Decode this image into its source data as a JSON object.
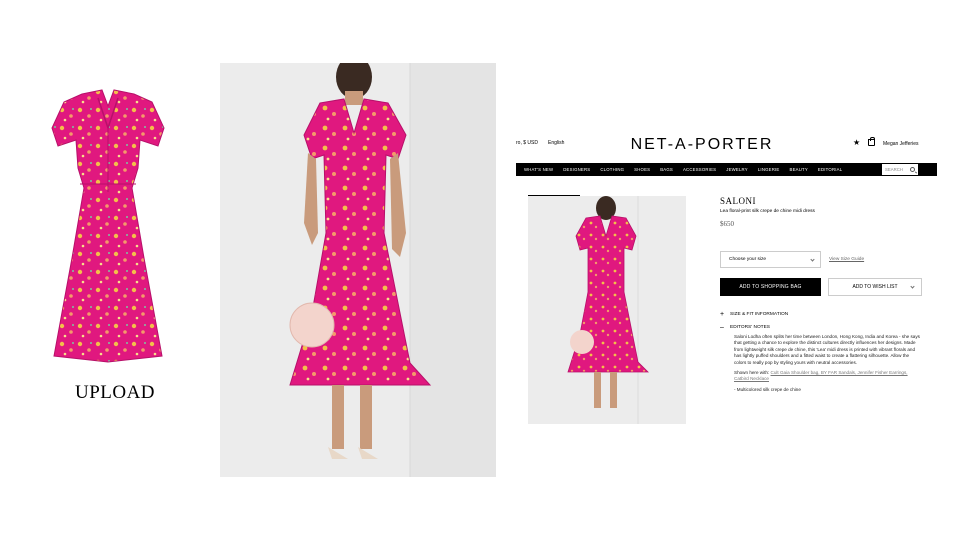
{
  "upload": {
    "label": "UPLOAD"
  },
  "store": {
    "logo": "NET-A-PORTER",
    "currency": "ro, $ USD",
    "language": "English",
    "account_name": "Megan Jefferies",
    "nav": [
      "WHAT'S NEW",
      "DESIGNERS",
      "CLOTHING",
      "SHOES",
      "BAGS",
      "ACCESSORIES",
      "JEWELRY",
      "LINGERIE",
      "BEAUTY",
      "EDITORIAL"
    ],
    "search_label": "SEARCH",
    "product": {
      "brand": "SALONI",
      "name": "Lea floral-print silk crepe de chine midi dress",
      "price": "$650",
      "size_placeholder": "Choose your size",
      "size_guide": "View Size Guide",
      "add_to_bag": "ADD TO SHOPPING BAG",
      "add_to_wishlist": "ADD TO WISH LIST",
      "section_size_fit": "SIZE & FIT INFORMATION",
      "section_editors_notes": "EDITORS' NOTES",
      "notes_body": "Saloni Lodha often splits her time between London, Hong Kong, India and Korea - she says that getting a chance to explore the distinct cultures directly influences her designs. Made from lightweight silk crepe de chine, this 'Lea' midi dress is printed with vibrant florals and has lightly puffed shoulders and a fitted waist to create a flattering silhouette. Allow the colors to really pop by styling yours with neutral accessories.",
      "shown_here_prefix": "Shown here with:",
      "shown_here_items": "Cult Gaia Shoulder bag, BY FAR Sandals, Jennifer Fisher Earrings, Catbird Necklace",
      "bullet_1": "- Multicolored silk crepe de chine"
    }
  },
  "colors": {
    "dress_pink": "#e0187f",
    "dress_dark": "#b8106a",
    "print_yellow": "#f3c04a",
    "print_peach": "#f49a6a",
    "nav_black": "#000000"
  }
}
